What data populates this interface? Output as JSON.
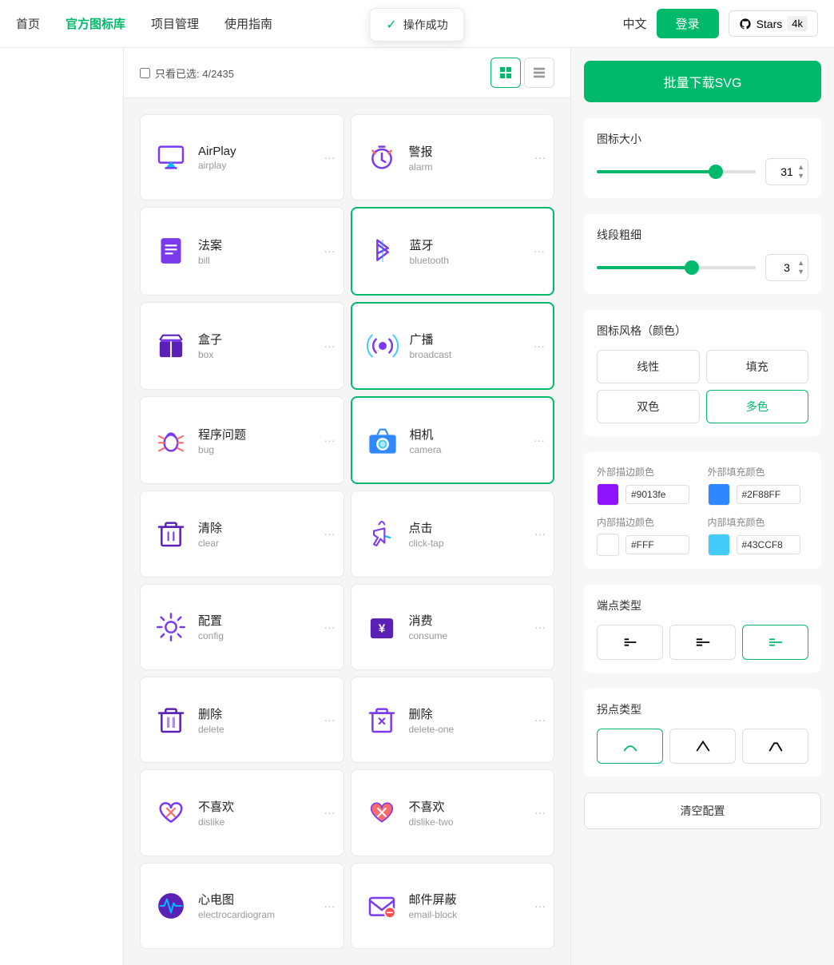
{
  "header": {
    "nav": [
      {
        "label": "首页",
        "active": false
      },
      {
        "label": "官方图标库",
        "active": true
      },
      {
        "label": "项目管理",
        "active": false
      },
      {
        "label": "使用指南",
        "active": false
      }
    ],
    "lang": "中文",
    "login_label": "登录",
    "stars_label": "Stars",
    "stars_count": "4k"
  },
  "toast": {
    "text": "操作成功"
  },
  "toolbar": {
    "filter_label": "只看已选: 4/2435",
    "view_grid_label": "⊞",
    "view_list_label": "⊟"
  },
  "right_panel": {
    "download_btn": "批量下载SVG",
    "icon_size_label": "图标大小",
    "icon_size_value": "31",
    "stroke_label": "线段粗细",
    "stroke_value": "3",
    "style_label": "图标风格（颜色）",
    "style_options": [
      {
        "label": "线性",
        "active": false
      },
      {
        "label": "填充",
        "active": false
      },
      {
        "label": "双色",
        "active": false
      },
      {
        "label": "多色",
        "active": true
      }
    ],
    "outer_stroke_label": "外部描边颜色",
    "outer_fill_label": "外部填充颜色",
    "outer_stroke_color": "#9013fe",
    "outer_fill_color": "#2F88FF",
    "inner_stroke_label": "内部描边颜色",
    "inner_fill_label": "内部填充颜色",
    "inner_stroke_color": "#FFF",
    "inner_fill_color": "#43CCF8",
    "endpoint_label": "端点类型",
    "endpoint_options": [
      {
        "symbol": "⌐",
        "active": false
      },
      {
        "symbol": "⌐",
        "active": false
      },
      {
        "symbol": "⌐",
        "active": true
      }
    ],
    "node_label": "拐点类型",
    "node_options": [
      {
        "symbol": "⌐",
        "active": true
      },
      {
        "symbol": "⌐",
        "active": false
      },
      {
        "symbol": "⌐",
        "active": false
      }
    ],
    "clear_btn": "清空配置"
  },
  "icons": [
    {
      "zh": "AirPlay",
      "en": "airplay",
      "selected": false,
      "color1": "#7c3aed",
      "color2": "#00b8ff"
    },
    {
      "zh": "警报",
      "en": "alarm",
      "selected": false,
      "color1": "#7c3aed",
      "color2": "#ff6b6b"
    },
    {
      "zh": "法案",
      "en": "bill",
      "selected": false,
      "color1": "#7c3aed",
      "color2": "#7c3aed"
    },
    {
      "zh": "蓝牙",
      "en": "bluetooth",
      "selected": true,
      "color1": "#7c3aed",
      "color2": "#00b8ff"
    },
    {
      "zh": "盒子",
      "en": "box",
      "selected": false,
      "color1": "#5b21b6",
      "color2": "#5b21b6"
    },
    {
      "zh": "广播",
      "en": "broadcast",
      "selected": true,
      "color1": "#7c3aed",
      "color2": "#00b8ff"
    },
    {
      "zh": "程序问题",
      "en": "bug",
      "selected": false,
      "color1": "#7c3aed",
      "color2": "#ff6b6b"
    },
    {
      "zh": "相机",
      "en": "camera",
      "selected": true,
      "color1": "#2F88FF",
      "color2": "#43CCF8"
    },
    {
      "zh": "清除",
      "en": "clear",
      "selected": false,
      "color1": "#5b21b6",
      "color2": "#5b21b6"
    },
    {
      "zh": "点击",
      "en": "click-tap",
      "selected": false,
      "color1": "#7c3aed",
      "color2": "#00b8ff"
    },
    {
      "zh": "配置",
      "en": "config",
      "selected": false,
      "color1": "#7c3aed",
      "color2": "#7c3aed"
    },
    {
      "zh": "消费",
      "en": "consume",
      "selected": false,
      "color1": "#5b21b6",
      "color2": "#5b21b6"
    },
    {
      "zh": "删除",
      "en": "delete",
      "selected": false,
      "color1": "#5b21b6",
      "color2": "#5b21b6"
    },
    {
      "zh": "删除",
      "en": "delete-one",
      "selected": false,
      "color1": "#7c3aed",
      "color2": "#7c3aed"
    },
    {
      "zh": "不喜欢",
      "en": "dislike",
      "selected": false,
      "color1": "#7c3aed",
      "color2": "#ff6b6b"
    },
    {
      "zh": "不喜欢",
      "en": "dislike-two",
      "selected": false,
      "color1": "#7c3aed",
      "color2": "#ff6b6b"
    },
    {
      "zh": "心电图",
      "en": "electrocardiogram",
      "selected": false,
      "color1": "#5b21b6",
      "color2": "#00b8ff"
    },
    {
      "zh": "邮件屏蔽",
      "en": "email-block",
      "selected": false,
      "color1": "#7c3aed",
      "color2": "#7c3aed"
    }
  ]
}
